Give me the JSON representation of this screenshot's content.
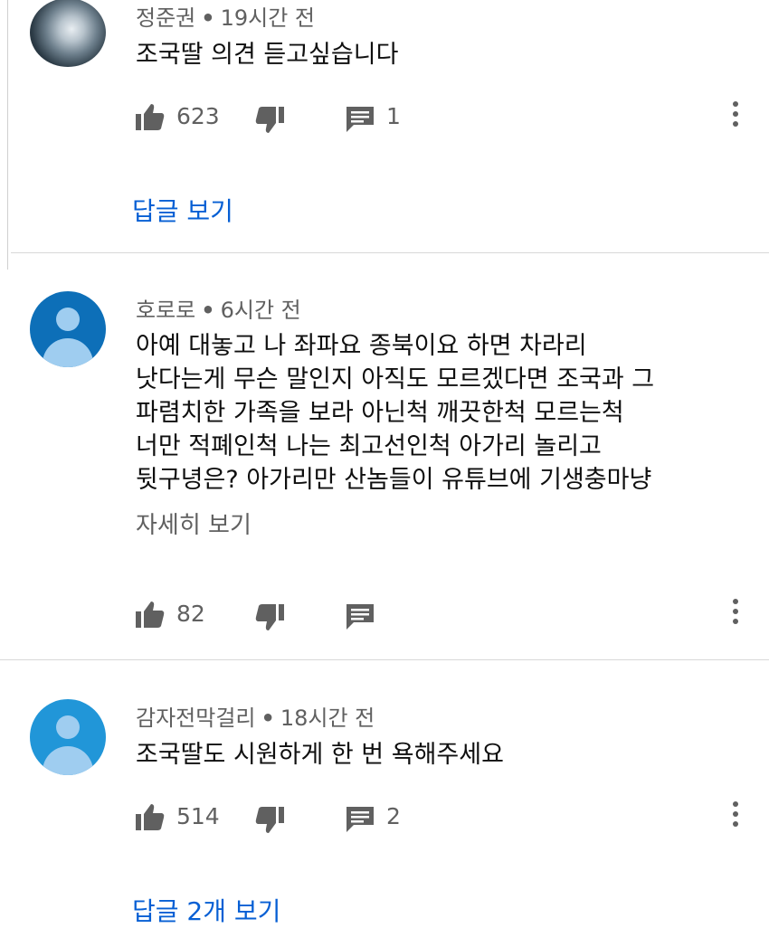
{
  "comments": [
    {
      "author": "정준권",
      "time": "19시간 전",
      "text": [
        "조국딸 의견 듣고싶습니다"
      ],
      "likes": "623",
      "reply_count": "1",
      "view_replies": "답글 보기",
      "avatar": "photo"
    },
    {
      "author": "호로로",
      "time": "6시간 전",
      "text": [
        "아예 대놓고 나 좌파요 종북이요 하면 차라리",
        "낫다는게 무슨 말인지 아직도 모르겠다면 조국과 그",
        "파렴치한 가족을 보라 아닌척 깨끗한척 모르는척",
        "너만 적폐인척 나는 최고선인척 아가리 놀리고",
        "뒷구녕은? 아가리만 산놈들이 유튜브에 기생충마냥"
      ],
      "read_more": "자세히 보기",
      "likes": "82",
      "avatar": "default"
    },
    {
      "author": "감자전막걸리",
      "time": "18시간 전",
      "text": [
        "조국딸도 시원하게 한 번 욕해주세요"
      ],
      "likes": "514",
      "reply_count": "2",
      "view_replies": "답글 2개 보기",
      "avatar": "default"
    }
  ],
  "icons": {
    "like": "thumbs-up-icon",
    "dislike": "thumbs-down-icon",
    "reply": "reply-icon",
    "menu": "more-vert-icon"
  },
  "colors": {
    "link": "#065fd4",
    "secondary": "#606060",
    "avatar_default": "#0d6fb8"
  },
  "separator": "•"
}
